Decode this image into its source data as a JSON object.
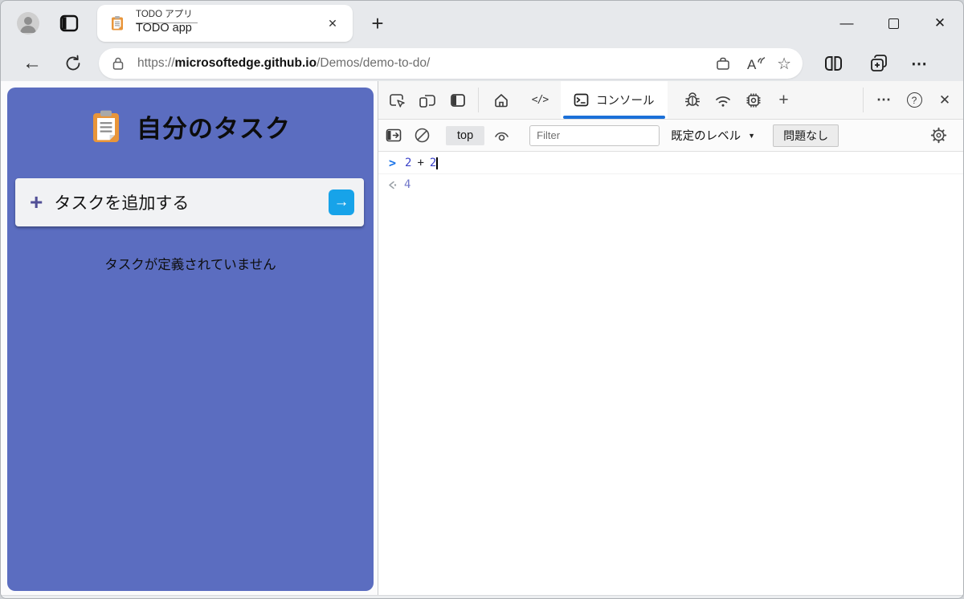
{
  "titlebar": {
    "tab_tooltip": "TODO アプリ",
    "tab_title": "TODO app"
  },
  "toolbar": {
    "url_scheme": "https://",
    "url_domain": "microsoftedge.github.io",
    "url_path": "/Demos/demo-to-do/"
  },
  "app": {
    "title": "自分のタスク",
    "add_task_label": "タスクを追加する",
    "empty_message": "タスクが定義されていません"
  },
  "devtools": {
    "tabs": {
      "console_label": "コンソール"
    },
    "toolbar": {
      "context_selector": "top",
      "filter_placeholder": "Filter",
      "levels_label": "既定のレベル",
      "issues_label": "問題なし"
    },
    "console": {
      "input_tokens": {
        "a": "2",
        "op": "+",
        "b": "2"
      },
      "result_value": "4"
    }
  },
  "glyphs": {
    "back": "←",
    "new_tab": "+",
    "close_tab": "✕",
    "minimize": "—",
    "close_window": "✕",
    "star": "☆",
    "more_menu": "⋯",
    "read_aloud_letter": "A",
    "code_tab": "</>",
    "more_tools": "+",
    "devtools_more": "⋯",
    "help": "?",
    "close_devtools": "✕",
    "levels_caret": "▼",
    "add_plus": "+",
    "submit_arrow": "→",
    "console_prompt": ">"
  },
  "colors": {
    "accent_purple": "#5b6dc0",
    "submit_blue": "#17a3e9",
    "tab_underline_blue": "#1b70d8",
    "prompt_blue": "#1a73e8",
    "number_blue": "#3a41c8",
    "result_purple": "#7277ca"
  }
}
